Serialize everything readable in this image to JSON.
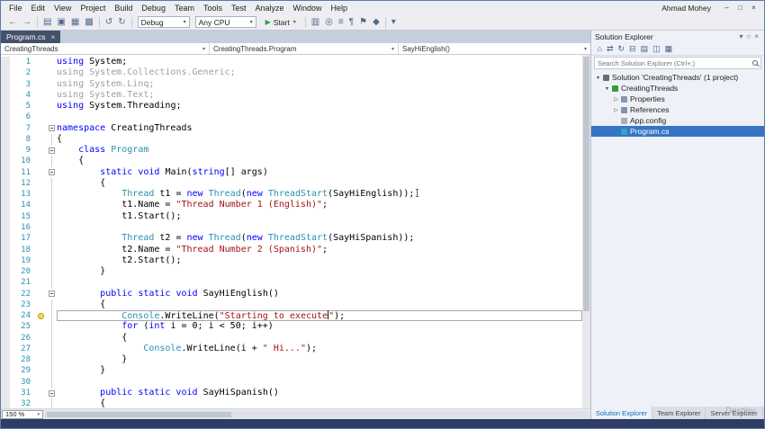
{
  "menubar": {
    "items": [
      "File",
      "Edit",
      "View",
      "Project",
      "Build",
      "Debug",
      "Team",
      "Tools",
      "Test",
      "Analyze",
      "Window",
      "Help"
    ],
    "user": "Ahmad Mohey",
    "window_buttons": [
      {
        "name": "minimize-button",
        "glyph": "–"
      },
      {
        "name": "maximize-button",
        "glyph": "□"
      },
      {
        "name": "close-button",
        "glyph": "×"
      }
    ]
  },
  "toolbar": {
    "left_icons": [
      {
        "name": "navigate-back-icon",
        "glyph": "←"
      },
      {
        "name": "navigate-forward-icon",
        "glyph": "→"
      },
      {
        "sep": true
      },
      {
        "name": "new-file-icon",
        "glyph": "▤"
      },
      {
        "name": "open-file-icon",
        "glyph": "▣"
      },
      {
        "name": "save-icon",
        "glyph": "▦"
      },
      {
        "name": "save-all-icon",
        "glyph": "▩"
      },
      {
        "sep": true
      },
      {
        "name": "undo-icon",
        "glyph": "↺"
      },
      {
        "name": "redo-icon",
        "glyph": "↻"
      },
      {
        "sep": true
      }
    ],
    "config_dropdown": "Debug",
    "platform_dropdown": "Any CPU",
    "start_button": "Start",
    "right_icons": [
      {
        "sep": true
      },
      {
        "name": "build-icon",
        "glyph": "▥"
      },
      {
        "name": "find-icon",
        "glyph": "◎"
      },
      {
        "name": "comment-icon",
        "glyph": "≡"
      },
      {
        "name": "uncomment-icon",
        "glyph": "¶"
      },
      {
        "name": "bookmark-icon",
        "glyph": "⚑"
      },
      {
        "name": "next-bookmark-icon",
        "glyph": "◆"
      },
      {
        "sep": true
      },
      {
        "name": "toolbar-overflow-icon",
        "glyph": "▾"
      }
    ]
  },
  "editor": {
    "tab": {
      "title": "Program.cs",
      "close": "×"
    },
    "breadcrumb": [
      {
        "label": "CreatingThreads"
      },
      {
        "label": "CreatingThreads.Program"
      },
      {
        "label": "SayHiEnglish()"
      }
    ],
    "zoom": "150 %",
    "colors": {
      "keyword": "#0000ff",
      "type": "#2b91af",
      "string": "#a31515",
      "inactive": "#9f9f9f",
      "line_number": "#2b91af"
    },
    "lines": [
      {
        "n": 1,
        "t": [
          [
            "kw",
            "using"
          ],
          [
            "pl",
            " System;"
          ]
        ]
      },
      {
        "n": 2,
        "t": [
          [
            "gr",
            "using System.Collections.Generic;"
          ]
        ]
      },
      {
        "n": 3,
        "t": [
          [
            "gr",
            "using System.Linq;"
          ]
        ]
      },
      {
        "n": 4,
        "t": [
          [
            "gr",
            "using System.Text;"
          ]
        ]
      },
      {
        "n": 5,
        "t": [
          [
            "kw",
            "using"
          ],
          [
            "pl",
            " System.Threading;"
          ]
        ]
      },
      {
        "n": 6,
        "t": []
      },
      {
        "n": 7,
        "fold": true,
        "t": [
          [
            "kw",
            "namespace"
          ],
          [
            "pl",
            " CreatingThreads"
          ]
        ]
      },
      {
        "n": 8,
        "t": [
          [
            "pl",
            "{"
          ]
        ]
      },
      {
        "n": 9,
        "fold": true,
        "t": [
          [
            "pl",
            "    "
          ],
          [
            "kw",
            "class"
          ],
          [
            "pl",
            " "
          ],
          [
            "ty",
            "Program"
          ]
        ]
      },
      {
        "n": 10,
        "t": [
          [
            "pl",
            "    {"
          ]
        ]
      },
      {
        "n": 11,
        "fold": true,
        "t": [
          [
            "pl",
            "        "
          ],
          [
            "kw",
            "static"
          ],
          [
            "pl",
            " "
          ],
          [
            "kw",
            "void"
          ],
          [
            "pl",
            " Main("
          ],
          [
            "kw",
            "string"
          ],
          [
            "pl",
            "[] args)"
          ]
        ]
      },
      {
        "n": 12,
        "t": [
          [
            "pl",
            "        {"
          ]
        ]
      },
      {
        "n": 13,
        "t": [
          [
            "pl",
            "            "
          ],
          [
            "ty",
            "Thread"
          ],
          [
            "pl",
            " t1 = "
          ],
          [
            "kw",
            "new"
          ],
          [
            "pl",
            " "
          ],
          [
            "ty",
            "Thread"
          ],
          [
            "pl",
            "("
          ],
          [
            "kw",
            "new"
          ],
          [
            "pl",
            " "
          ],
          [
            "ty",
            "ThreadStart"
          ],
          [
            "pl",
            "(SayHiEnglish));"
          ],
          [
            "ibeam",
            ""
          ]
        ]
      },
      {
        "n": 14,
        "t": [
          [
            "pl",
            "            t1.Name = "
          ],
          [
            "st",
            "\"Thread Number 1 (English)\""
          ],
          [
            "pl",
            ";"
          ]
        ]
      },
      {
        "n": 15,
        "t": [
          [
            "pl",
            "            t1.Start();"
          ]
        ]
      },
      {
        "n": 16,
        "t": []
      },
      {
        "n": 17,
        "t": [
          [
            "pl",
            "            "
          ],
          [
            "ty",
            "Thread"
          ],
          [
            "pl",
            " t2 = "
          ],
          [
            "kw",
            "new"
          ],
          [
            "pl",
            " "
          ],
          [
            "ty",
            "Thread"
          ],
          [
            "pl",
            "("
          ],
          [
            "kw",
            "new"
          ],
          [
            "pl",
            " "
          ],
          [
            "ty",
            "ThreadStart"
          ],
          [
            "pl",
            "(SayHiSpanish));"
          ]
        ]
      },
      {
        "n": 18,
        "t": [
          [
            "pl",
            "            t2.Name = "
          ],
          [
            "st",
            "\"Thread Number 2 (Spanish)\""
          ],
          [
            "pl",
            ";"
          ]
        ]
      },
      {
        "n": 19,
        "t": [
          [
            "pl",
            "            t2.Start();"
          ]
        ]
      },
      {
        "n": 20,
        "t": [
          [
            "pl",
            "        }"
          ]
        ]
      },
      {
        "n": 21,
        "t": []
      },
      {
        "n": 22,
        "fold": true,
        "t": [
          [
            "pl",
            "        "
          ],
          [
            "kw",
            "public"
          ],
          [
            "pl",
            " "
          ],
          [
            "kw",
            "static"
          ],
          [
            "pl",
            " "
          ],
          [
            "kw",
            "void"
          ],
          [
            "pl",
            " SayHiEnglish()"
          ]
        ]
      },
      {
        "n": 23,
        "t": [
          [
            "pl",
            "        {"
          ]
        ]
      },
      {
        "n": 24,
        "bulb": true,
        "current": true,
        "t": [
          [
            "pl",
            "            "
          ],
          [
            "ty",
            "Console"
          ],
          [
            "pl",
            ".WriteLine("
          ],
          [
            "st",
            "\"Starting to execute"
          ],
          [
            "caret",
            ""
          ],
          [
            "st",
            "\""
          ],
          [
            "pl",
            ");"
          ]
        ]
      },
      {
        "n": 25,
        "t": [
          [
            "pl",
            "            "
          ],
          [
            "kw",
            "for"
          ],
          [
            "pl",
            " ("
          ],
          [
            "kw",
            "int"
          ],
          [
            "pl",
            " i = 0; i < 50; i++)"
          ]
        ]
      },
      {
        "n": 26,
        "t": [
          [
            "pl",
            "            {"
          ]
        ]
      },
      {
        "n": 27,
        "t": [
          [
            "pl",
            "                "
          ],
          [
            "ty",
            "Console"
          ],
          [
            "pl",
            ".WriteLine(i + "
          ],
          [
            "st",
            "\" Hi...\""
          ],
          [
            "pl",
            ");"
          ]
        ]
      },
      {
        "n": 28,
        "t": [
          [
            "pl",
            "            }"
          ]
        ]
      },
      {
        "n": 29,
        "t": [
          [
            "pl",
            "        }"
          ]
        ]
      },
      {
        "n": 30,
        "t": []
      },
      {
        "n": 31,
        "fold": true,
        "t": [
          [
            "pl",
            "        "
          ],
          [
            "kw",
            "public"
          ],
          [
            "pl",
            " "
          ],
          [
            "kw",
            "static"
          ],
          [
            "pl",
            " "
          ],
          [
            "kw",
            "void"
          ],
          [
            "pl",
            " SayHiSpanish()"
          ]
        ]
      },
      {
        "n": 32,
        "t": [
          [
            "pl",
            "        {"
          ]
        ]
      }
    ]
  },
  "solution_explorer": {
    "title": "Solution Explorer",
    "header_icons": [
      {
        "name": "window-position-icon",
        "glyph": "▾"
      },
      {
        "name": "pin-icon",
        "glyph": "○"
      },
      {
        "name": "close-icon",
        "glyph": "×"
      }
    ],
    "toolbar_icons": [
      {
        "name": "home-icon",
        "glyph": "⌂"
      },
      {
        "name": "sync-with-active-document-icon",
        "glyph": "⇄"
      },
      {
        "name": "refresh-icon",
        "glyph": "↻"
      },
      {
        "name": "collapse-all-icon",
        "glyph": "⊟"
      },
      {
        "name": "show-all-files-icon",
        "glyph": "▤"
      },
      {
        "name": "preview-selected-items-icon",
        "glyph": "◫"
      },
      {
        "name": "properties-toolbar-icon",
        "glyph": "▦"
      }
    ],
    "search_placeholder": "Search Solution Explorer (Ctrl+;)",
    "tree": [
      {
        "label": "Solution 'CreatingThreads' (1 project)",
        "depth": 0,
        "expand": "open",
        "icon": "solution-icon"
      },
      {
        "label": "CreatingThreads",
        "depth": 1,
        "expand": "open",
        "icon": "project-icon"
      },
      {
        "label": "Properties",
        "depth": 2,
        "expand": "closed",
        "icon": "properties-icon"
      },
      {
        "label": "References",
        "depth": 2,
        "expand": "closed",
        "icon": "references-icon"
      },
      {
        "label": "App.config",
        "depth": 2,
        "icon": "config-icon"
      },
      {
        "label": "Program.cs",
        "depth": 2,
        "icon": "csharp-file-icon",
        "selected": true
      }
    ],
    "tabs": [
      {
        "label": "Solution Explorer",
        "active": true
      },
      {
        "label": "Team Explorer",
        "active": false
      },
      {
        "label": "Server Explorer",
        "active": false
      }
    ]
  },
  "watermark": "Destiny"
}
